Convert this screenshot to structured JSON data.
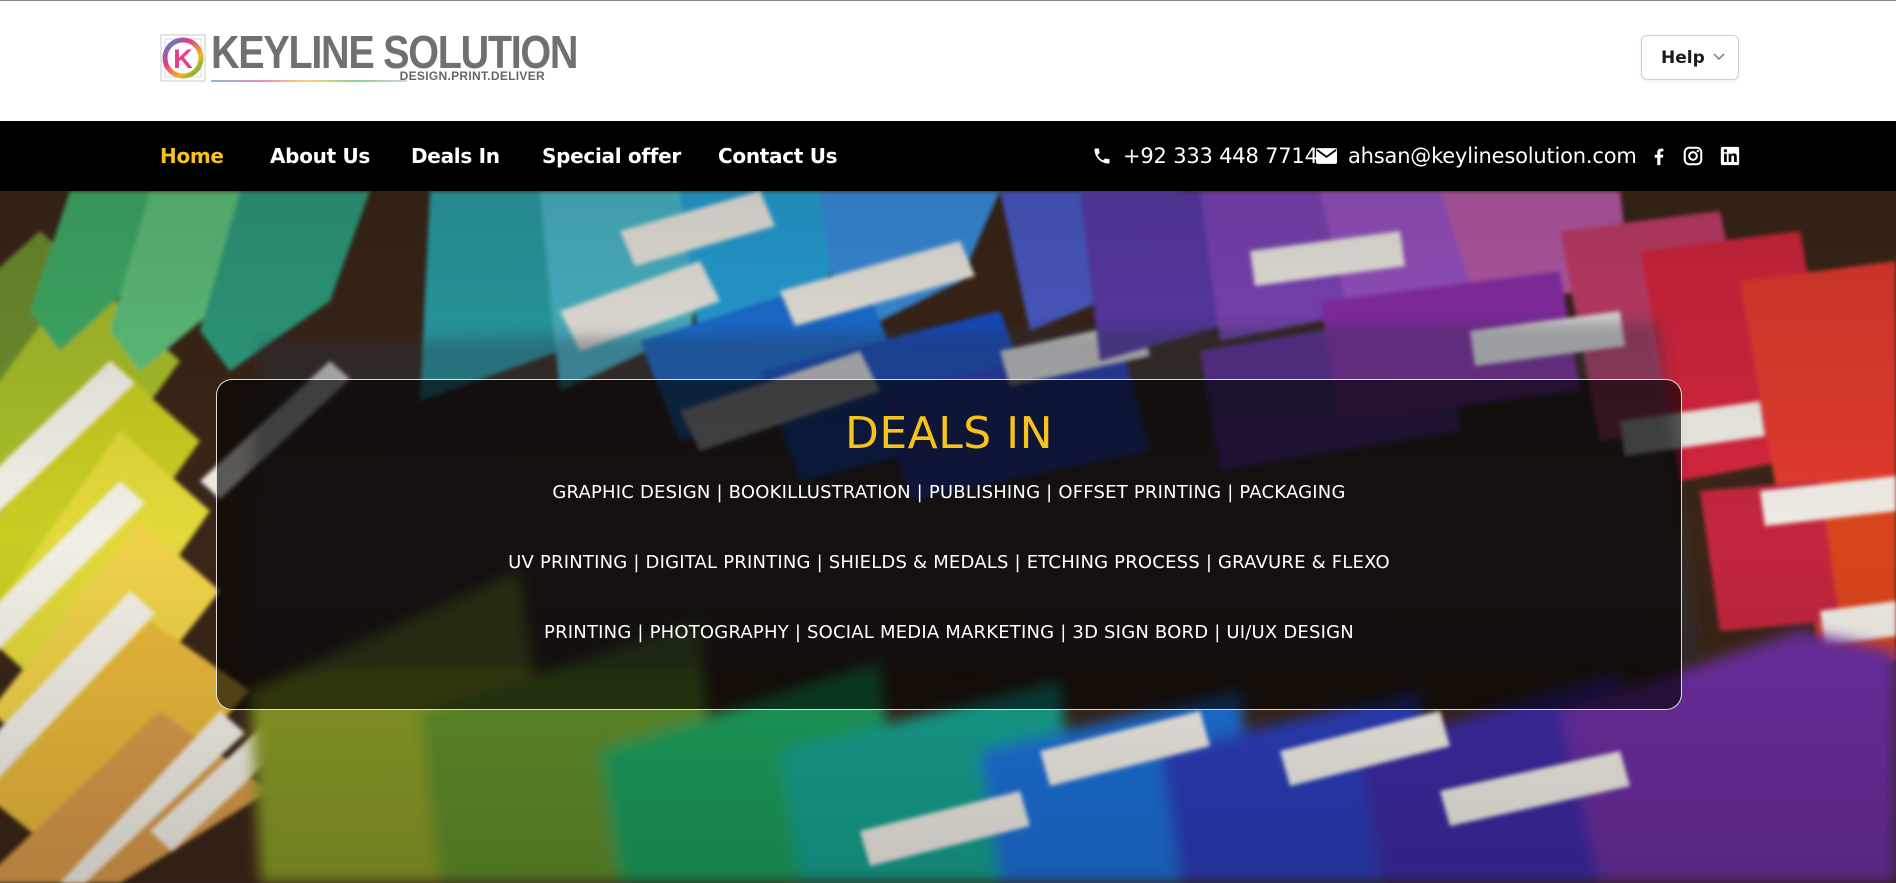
{
  "brand": {
    "name": "KEYLINE SOLUTION",
    "tagline": "DESIGN.PRINT.DELIVER",
    "mark_letter": "K"
  },
  "help": {
    "label": "Help"
  },
  "nav": {
    "items": [
      {
        "label": "Home",
        "active": true
      },
      {
        "label": "About Us",
        "active": false
      },
      {
        "label": "Deals In",
        "active": false
      },
      {
        "label": "Special offer",
        "active": false
      },
      {
        "label": "Contact Us",
        "active": false
      }
    ]
  },
  "contact": {
    "phone": "+92 333 448 7714",
    "email": "ahsan@keylinesolution.com",
    "social": [
      "facebook-icon",
      "instagram-icon",
      "linkedin-icon"
    ]
  },
  "hero": {
    "title": "DEALS IN",
    "lines": [
      "GRAPHIC DESIGN | BOOKILLUSTRATION | PUBLISHING | OFFSET PRINTING | PACKAGING",
      "UV PRINTING | DIGITAL PRINTING | SHIELDS & MEDALS | ETCHING PROCESS | GRAVURE & FLEXO",
      "PRINTING | PHOTOGRAPHY | SOCIAL MEDIA MARKETING | 3D SIGN BORD | UI/UX DESIGN"
    ]
  },
  "colors": {
    "accent": "#f7c21a",
    "navbar_bg": "#000000",
    "logo_text": "#707070"
  }
}
